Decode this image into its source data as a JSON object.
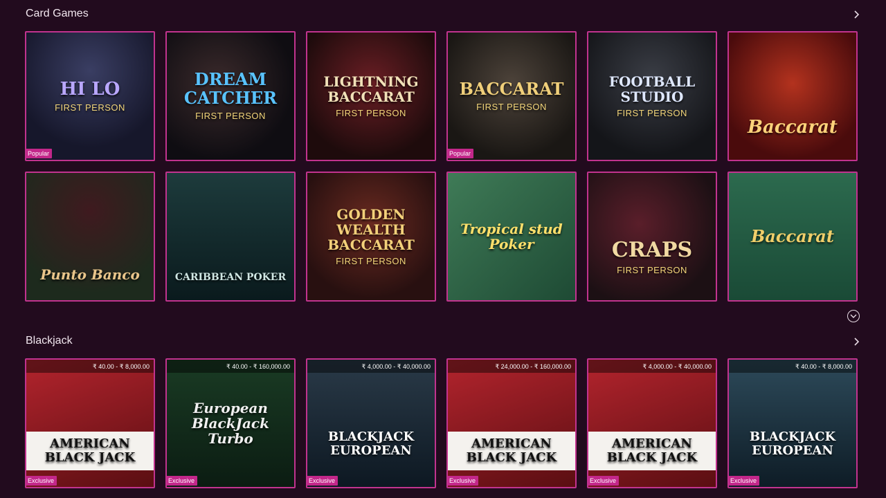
{
  "sections": [
    {
      "title": "Card Games",
      "tiles": [
        {
          "name": "HI LO",
          "sub": "FIRST PERSON",
          "badge": "Popular"
        },
        {
          "name": "DREAM CATCHER",
          "sub": "FIRST PERSON",
          "badge": ""
        },
        {
          "name": "LIGHTNING BACCARAT",
          "sub": "FIRST PERSON",
          "badge": ""
        },
        {
          "name": "BACCARAT",
          "sub": "FIRST PERSON",
          "badge": "Popular"
        },
        {
          "name": "FOOTBALL STUDIO",
          "sub": "FIRST PERSON",
          "badge": ""
        },
        {
          "name": "Baccarat",
          "sub": "",
          "badge": ""
        },
        {
          "name": "Punto Banco",
          "sub": "",
          "badge": ""
        },
        {
          "name": "CARIBBEAN POKER",
          "sub": "",
          "badge": ""
        },
        {
          "name": "GOLDEN WEALTH BACCARAT",
          "sub": "FIRST PERSON",
          "badge": ""
        },
        {
          "name": "Tropical stud Poker",
          "sub": "",
          "badge": ""
        },
        {
          "name": "CRAPS",
          "sub": "FIRST PERSON",
          "badge": ""
        },
        {
          "name": "Baccarat",
          "sub": "",
          "badge": ""
        }
      ]
    },
    {
      "title": "Blackjack",
      "tiles": [
        {
          "name": "AMERICAN BLACK JACK",
          "range": "₹ 40.00 - ₹ 8,000.00",
          "badge": "Exclusive"
        },
        {
          "name": "European BlackJack Turbo",
          "range": "₹ 40.00 - ₹ 160,000.00",
          "badge": "Exclusive"
        },
        {
          "name": "BLACKJACK EUROPEAN",
          "range": "₹ 4,000.00 - ₹ 40,000.00",
          "badge": "Exclusive"
        },
        {
          "name": "AMERICAN BLACK JACK",
          "range": "₹ 24,000.00 - ₹ 160,000.00",
          "badge": "Exclusive"
        },
        {
          "name": "AMERICAN BLACK JACK",
          "range": "₹ 4,000.00 - ₹ 40,000.00",
          "badge": "Exclusive"
        },
        {
          "name": "BLACKJACK EUROPEAN",
          "range": "₹ 40.00 - ₹ 8,000.00",
          "badge": "Exclusive"
        }
      ]
    }
  ],
  "icons": {
    "more": "chevron-right-icon",
    "expand": "chevron-down-icon"
  },
  "colors": {
    "background": "#220b1e",
    "tile_border": "#c2338f",
    "badge": "#c3278a"
  }
}
